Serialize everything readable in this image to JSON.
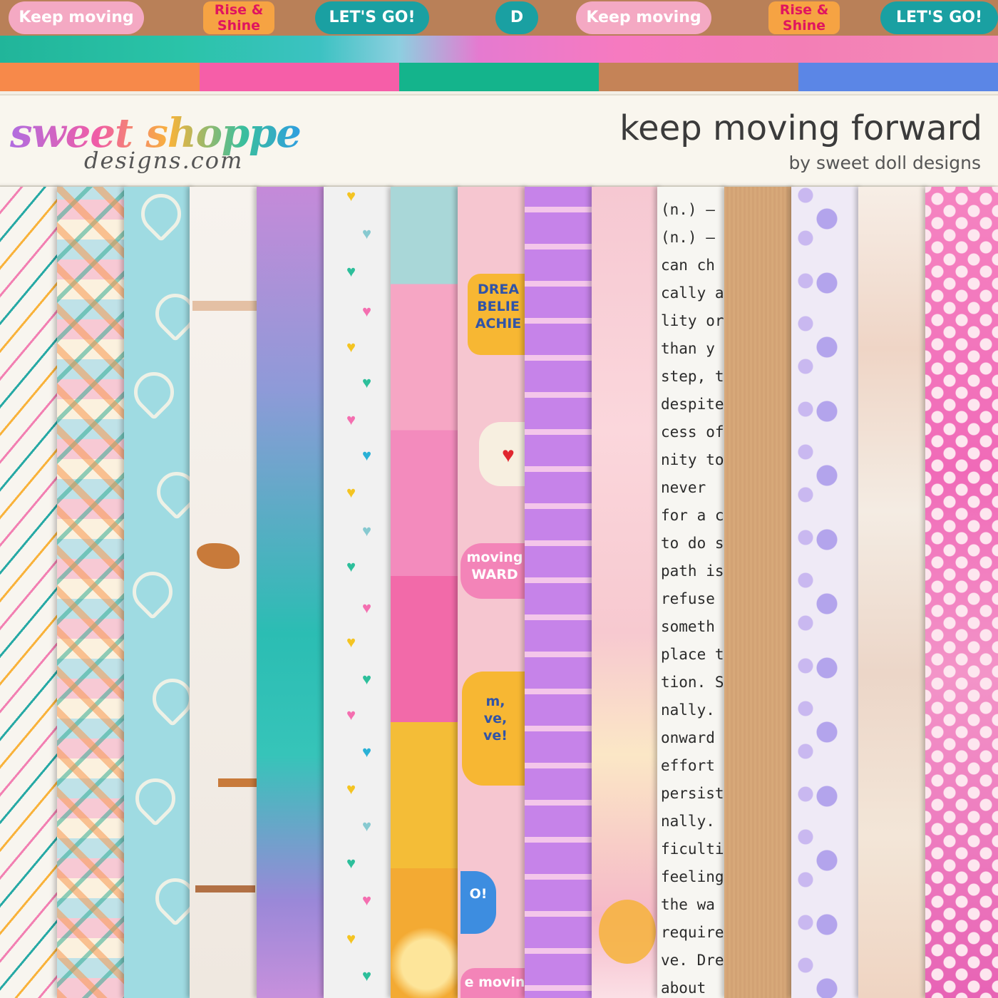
{
  "top_stickers": [
    {
      "text": "Keep moving",
      "style": "pink"
    },
    {
      "text": "Rise & Shine",
      "style": "orange"
    },
    {
      "text": "LET'S GO!",
      "style": "teal"
    },
    {
      "text": "D",
      "style": "teal"
    },
    {
      "text": "Keep moving",
      "style": "pink"
    },
    {
      "text": "Rise & Shine",
      "style": "orange"
    },
    {
      "text": "LET'S GO!",
      "style": "teal"
    }
  ],
  "color_blocks": [
    "#f7894a",
    "#f65ea8",
    "#14b48c",
    "#c58357",
    "#5b86e6"
  ],
  "banner": {
    "logo_main": "sweet shoppe",
    "logo_sub": "designs.com",
    "title": "keep moving forward",
    "byline": "by sweet doll designs"
  },
  "papers": {
    "quote_bubbles": {
      "dream": "DREA\nBELIE\nACHIE",
      "moving": "moving\nWARD",
      "dream_small": "m,\nve,\nve!",
      "go": "O!",
      "bottom": "e movin"
    },
    "text_lines": [
      "(n.) –",
      "(n.) –",
      "can ch",
      "cally a",
      "lity or",
      "than y",
      "step, t",
      "despite",
      "cess of",
      "nity to",
      "never",
      "for a c",
      "to do s",
      "path is",
      "refuse",
      "someth",
      "place t",
      "tion. S",
      "nally.",
      "onward",
      "effort",
      "persist",
      "nally.",
      "ficulti",
      "feeling",
      "the wa",
      "require",
      "ve. Dre",
      "about"
    ]
  }
}
